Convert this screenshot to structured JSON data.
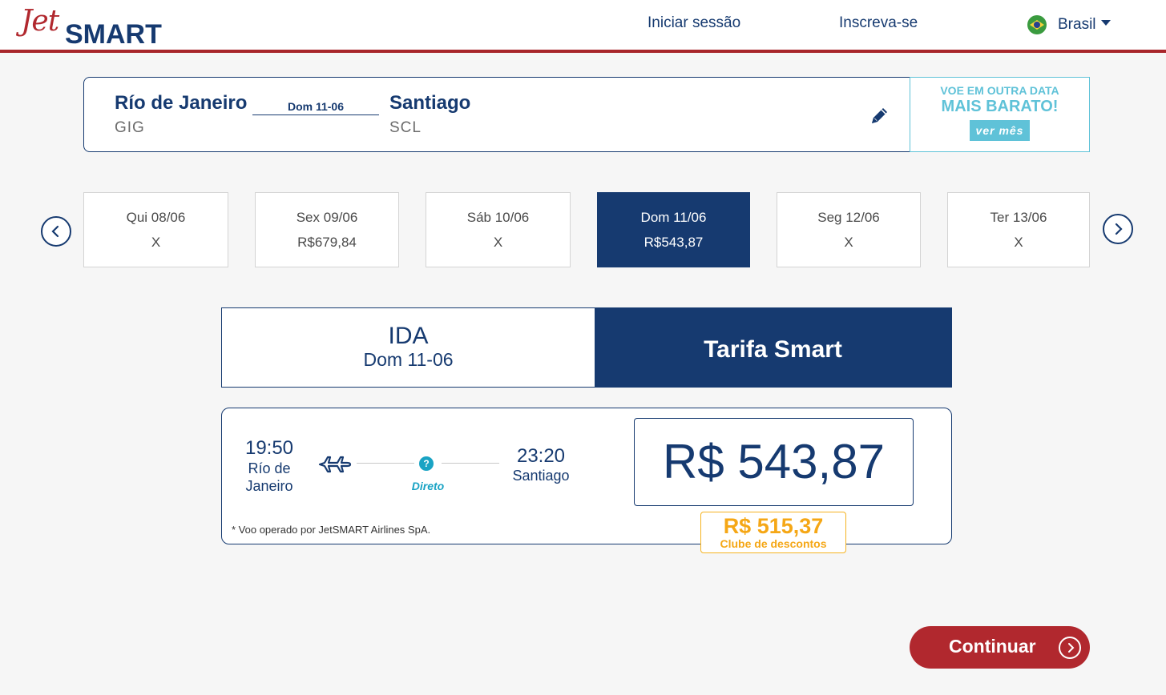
{
  "header": {
    "logo": {
      "part1": "Jet",
      "part2": "SMART"
    },
    "login_label": "Iniciar sessão",
    "signup_label": "Inscreva-se",
    "country_label": "Brasil",
    "flag_icon": "brazil-flag-icon"
  },
  "route": {
    "origin_city": "Río de Janeiro",
    "origin_code": "GIG",
    "date": "Dom 11-06",
    "destination_city": "Santiago",
    "destination_code": "SCL",
    "edit_icon": "pencil-icon"
  },
  "promo": {
    "line1": "VOE EM OUTRA DATA",
    "line2": "MAIS BARATO!",
    "button_label": "ver mês"
  },
  "dates": [
    {
      "label": "Qui 08/06",
      "price": "X",
      "selected": false
    },
    {
      "label": "Sex 09/06",
      "price": "R$679,84",
      "selected": false
    },
    {
      "label": "Sáb 10/06",
      "price": "X",
      "selected": false
    },
    {
      "label": "Dom 11/06",
      "price": "R$543,87",
      "selected": true
    },
    {
      "label": "Seg 12/06",
      "price": "X",
      "selected": false
    },
    {
      "label": "Ter 13/06",
      "price": "X",
      "selected": false
    }
  ],
  "fare_tabs": {
    "direction": "IDA",
    "date": "Dom 11-06",
    "fare_name": "Tarifa Smart"
  },
  "flight": {
    "departure_time": "19:50",
    "departure_city": "Río de Janeiro",
    "arrival_time": "23:20",
    "arrival_city": "Santiago",
    "stops_label": "Direto",
    "help_symbol": "?",
    "operated_by": "* Voo operado por JetSMART Airlines SpA.",
    "price": "R$ 543,87",
    "club_price": "R$ 515,37",
    "club_label": "Clube de descontos"
  },
  "continue_label": "Continuar",
  "colors": {
    "brand_navy": "#163a70",
    "brand_red": "#b1282e",
    "promo_cyan": "#5fc2d8",
    "club_orange": "#f5a716"
  }
}
